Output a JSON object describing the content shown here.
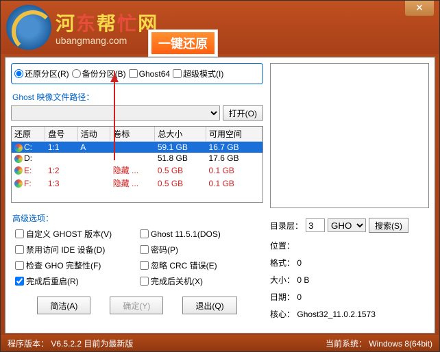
{
  "titlebar": {
    "logo_chars": [
      "河",
      "东",
      "帮",
      "忙",
      "网"
    ],
    "logo_sub": "ubangmang.com",
    "badge": "一键还原"
  },
  "modes": {
    "restore": "还原分区(R)",
    "backup": "备份分区(B)",
    "ghost64": "Ghost64",
    "super": "超级模式(I)",
    "selected": "restore"
  },
  "ghost_path_label": "Ghost 映像文件路径：",
  "open_btn": "打开(O)",
  "table": {
    "headers": [
      "还原",
      "盘号",
      "活动",
      "卷标",
      "总大小",
      "可用空间"
    ],
    "rows": [
      {
        "drive": "C:",
        "disk": "1:1",
        "active": "A",
        "label": "",
        "size": "59.1 GB",
        "free": "16.7 GB",
        "selected": true,
        "red": false
      },
      {
        "drive": "D:",
        "disk": "",
        "active": "",
        "label": "",
        "size": "51.8 GB",
        "free": "17.6 GB",
        "selected": false,
        "red": false
      },
      {
        "drive": "E:",
        "disk": "1:2",
        "active": "",
        "label": "隐藏 ...",
        "size": "0.5 GB",
        "free": "0.1 GB",
        "selected": false,
        "red": true
      },
      {
        "drive": "F:",
        "disk": "1:3",
        "active": "",
        "label": "隐藏 ...",
        "size": "0.5 GB",
        "free": "0.1 GB",
        "selected": false,
        "red": true
      }
    ]
  },
  "adv_label": "高级选项：",
  "adv": {
    "custom_ver": "自定义 GHOST 版本(V)",
    "ghost1151": "Ghost 11.5.1(DOS)",
    "deny_ide": "禁用访问 IDE 设备(D)",
    "password": "密码(P)",
    "check_gho": "检查 GHO 完整性(F)",
    "ignore_crc": "忽略 CRC 错误(E)",
    "reboot": "完成后重启(R)",
    "shutdown": "完成后关机(X)",
    "reboot_checked": true
  },
  "bottom": {
    "simplify": "简洁(A)",
    "ok": "确定(Y)",
    "exit": "退出(Q)"
  },
  "side": {
    "dir_level_label": "目录层：",
    "dir_level_value": "3",
    "ext": "GHO",
    "search_btn": "搜索(S)",
    "pos_label": "位置：",
    "format_label": "格式：",
    "format_value": "0",
    "size_label": "大小：",
    "size_value": "0 B",
    "date_label": "日期：",
    "date_value": "0",
    "core_label": "核心：",
    "core_value": "Ghost32_11.0.2.1573"
  },
  "status": {
    "left_prefix": "程序版本：",
    "version": "V6.5.2.2",
    "latest": "目前为最新版",
    "right_prefix": "当前系统：",
    "os": "Windows 8(64bit)"
  }
}
